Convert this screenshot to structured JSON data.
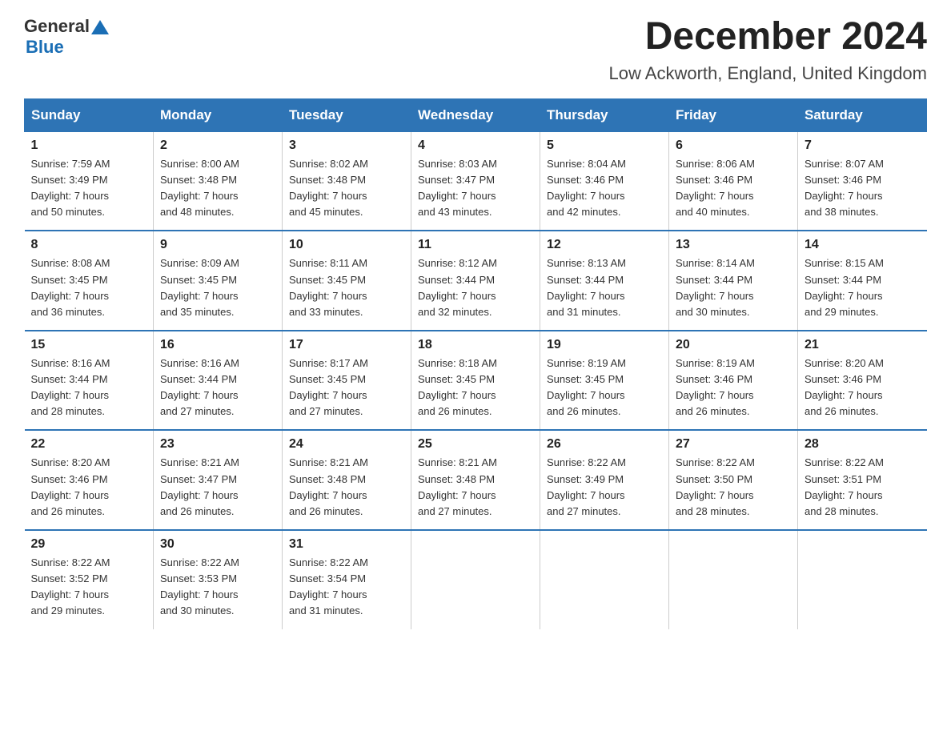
{
  "logo": {
    "general": "General",
    "blue": "Blue",
    "triangle_color": "#1a6eb5"
  },
  "title": "December 2024",
  "subtitle": "Low Ackworth, England, United Kingdom",
  "header_days": [
    "Sunday",
    "Monday",
    "Tuesday",
    "Wednesday",
    "Thursday",
    "Friday",
    "Saturday"
  ],
  "weeks": [
    [
      {
        "day": "1",
        "sunrise": "7:59 AM",
        "sunset": "3:49 PM",
        "daylight": "7 hours and 50 minutes."
      },
      {
        "day": "2",
        "sunrise": "8:00 AM",
        "sunset": "3:48 PM",
        "daylight": "7 hours and 48 minutes."
      },
      {
        "day": "3",
        "sunrise": "8:02 AM",
        "sunset": "3:48 PM",
        "daylight": "7 hours and 45 minutes."
      },
      {
        "day": "4",
        "sunrise": "8:03 AM",
        "sunset": "3:47 PM",
        "daylight": "7 hours and 43 minutes."
      },
      {
        "day": "5",
        "sunrise": "8:04 AM",
        "sunset": "3:46 PM",
        "daylight": "7 hours and 42 minutes."
      },
      {
        "day": "6",
        "sunrise": "8:06 AM",
        "sunset": "3:46 PM",
        "daylight": "7 hours and 40 minutes."
      },
      {
        "day": "7",
        "sunrise": "8:07 AM",
        "sunset": "3:46 PM",
        "daylight": "7 hours and 38 minutes."
      }
    ],
    [
      {
        "day": "8",
        "sunrise": "8:08 AM",
        "sunset": "3:45 PM",
        "daylight": "7 hours and 36 minutes."
      },
      {
        "day": "9",
        "sunrise": "8:09 AM",
        "sunset": "3:45 PM",
        "daylight": "7 hours and 35 minutes."
      },
      {
        "day": "10",
        "sunrise": "8:11 AM",
        "sunset": "3:45 PM",
        "daylight": "7 hours and 33 minutes."
      },
      {
        "day": "11",
        "sunrise": "8:12 AM",
        "sunset": "3:44 PM",
        "daylight": "7 hours and 32 minutes."
      },
      {
        "day": "12",
        "sunrise": "8:13 AM",
        "sunset": "3:44 PM",
        "daylight": "7 hours and 31 minutes."
      },
      {
        "day": "13",
        "sunrise": "8:14 AM",
        "sunset": "3:44 PM",
        "daylight": "7 hours and 30 minutes."
      },
      {
        "day": "14",
        "sunrise": "8:15 AM",
        "sunset": "3:44 PM",
        "daylight": "7 hours and 29 minutes."
      }
    ],
    [
      {
        "day": "15",
        "sunrise": "8:16 AM",
        "sunset": "3:44 PM",
        "daylight": "7 hours and 28 minutes."
      },
      {
        "day": "16",
        "sunrise": "8:16 AM",
        "sunset": "3:44 PM",
        "daylight": "7 hours and 27 minutes."
      },
      {
        "day": "17",
        "sunrise": "8:17 AM",
        "sunset": "3:45 PM",
        "daylight": "7 hours and 27 minutes."
      },
      {
        "day": "18",
        "sunrise": "8:18 AM",
        "sunset": "3:45 PM",
        "daylight": "7 hours and 26 minutes."
      },
      {
        "day": "19",
        "sunrise": "8:19 AM",
        "sunset": "3:45 PM",
        "daylight": "7 hours and 26 minutes."
      },
      {
        "day": "20",
        "sunrise": "8:19 AM",
        "sunset": "3:46 PM",
        "daylight": "7 hours and 26 minutes."
      },
      {
        "day": "21",
        "sunrise": "8:20 AM",
        "sunset": "3:46 PM",
        "daylight": "7 hours and 26 minutes."
      }
    ],
    [
      {
        "day": "22",
        "sunrise": "8:20 AM",
        "sunset": "3:46 PM",
        "daylight": "7 hours and 26 minutes."
      },
      {
        "day": "23",
        "sunrise": "8:21 AM",
        "sunset": "3:47 PM",
        "daylight": "7 hours and 26 minutes."
      },
      {
        "day": "24",
        "sunrise": "8:21 AM",
        "sunset": "3:48 PM",
        "daylight": "7 hours and 26 minutes."
      },
      {
        "day": "25",
        "sunrise": "8:21 AM",
        "sunset": "3:48 PM",
        "daylight": "7 hours and 27 minutes."
      },
      {
        "day": "26",
        "sunrise": "8:22 AM",
        "sunset": "3:49 PM",
        "daylight": "7 hours and 27 minutes."
      },
      {
        "day": "27",
        "sunrise": "8:22 AM",
        "sunset": "3:50 PM",
        "daylight": "7 hours and 28 minutes."
      },
      {
        "day": "28",
        "sunrise": "8:22 AM",
        "sunset": "3:51 PM",
        "daylight": "7 hours and 28 minutes."
      }
    ],
    [
      {
        "day": "29",
        "sunrise": "8:22 AM",
        "sunset": "3:52 PM",
        "daylight": "7 hours and 29 minutes."
      },
      {
        "day": "30",
        "sunrise": "8:22 AM",
        "sunset": "3:53 PM",
        "daylight": "7 hours and 30 minutes."
      },
      {
        "day": "31",
        "sunrise": "8:22 AM",
        "sunset": "3:54 PM",
        "daylight": "7 hours and 31 minutes."
      },
      null,
      null,
      null,
      null
    ]
  ],
  "labels": {
    "sunrise_prefix": "Sunrise: ",
    "sunset_prefix": "Sunset: ",
    "daylight_prefix": "Daylight: "
  }
}
